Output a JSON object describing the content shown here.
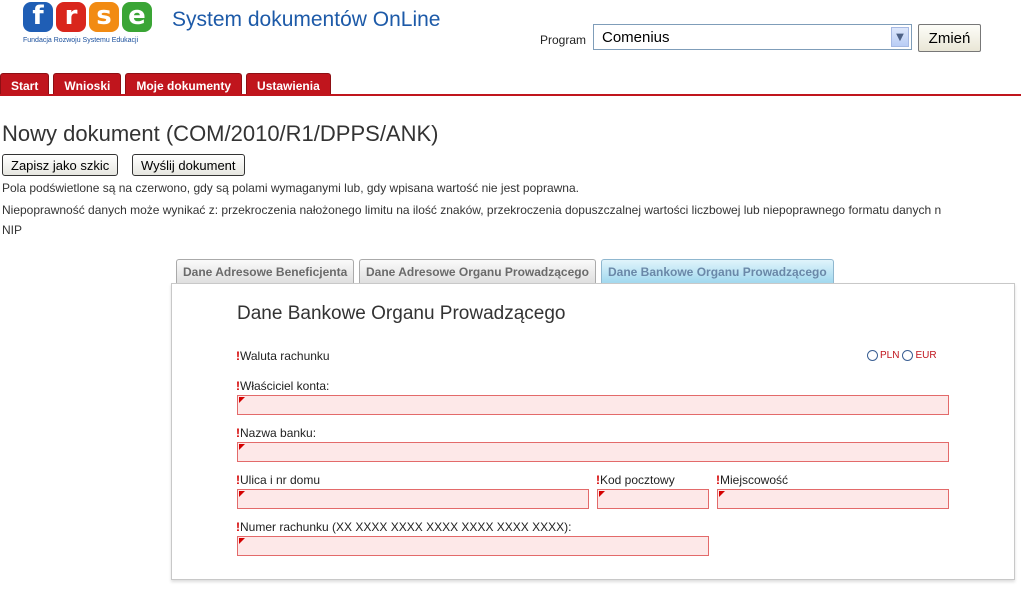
{
  "header": {
    "logo_letters": [
      "f",
      "r",
      "s",
      "e"
    ],
    "logo_colors": [
      "#1f5eb5",
      "#d9261c",
      "#f28b12",
      "#3aa535"
    ],
    "logo_subtitle": "Fundacja Rozwoju Systemu Edukacji",
    "app_title": "System dokumentów OnLine",
    "program_label": "Program",
    "program_value": "Comenius",
    "change_button": "Zmień"
  },
  "nav": {
    "tabs": [
      "Start",
      "Wnioski",
      "Moje dokumenty",
      "Ustawienia"
    ]
  },
  "main": {
    "title": "Nowy dokument (COM/2010/R1/DPPS/ANK)",
    "save_draft": "Zapisz jako szkic",
    "send": "Wyślij dokument",
    "notes": [
      "Pola podświetlone są na czerwono, gdy są polami wymaganymi lub, gdy wpisana wartość nie jest poprawna.",
      "Niepoprawność danych może wynikać z: przekroczenia nałożonego limitu na ilość znaków, przekroczenia dopuszczalnej wartości liczbowej lub niepoprawnego formatu danych n",
      "NIP"
    ]
  },
  "subtabs": [
    {
      "label": "Dane Adresowe Beneficjenta",
      "active": false
    },
    {
      "label": "Dane Adresowe Organu Prowadzącego",
      "active": false
    },
    {
      "label": "Dane Bankowe Organu Prowadzącego",
      "active": true
    }
  ],
  "form": {
    "title": "Dane Bankowe Organu Prowadzącego",
    "required_mark": "!",
    "currency_label": "Waluta rachunku",
    "currency_options": [
      "PLN",
      "EUR"
    ],
    "owner_label": "Właściciel konta:",
    "bank_label": "Nazwa banku:",
    "street_label": "Ulica i nr domu",
    "postcode_label": "Kod pocztowy",
    "city_label": "Miejscowość",
    "account_label": "Numer rachunku (XX XXXX XXXX XXXX XXXX XXXX XXXX):"
  },
  "colors": {
    "brand_red": "#c0151d",
    "invalid_field_bg": "#fde8e8",
    "title_blue": "#1d5aa8"
  }
}
